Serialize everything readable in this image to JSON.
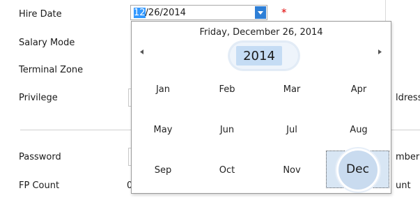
{
  "form": {
    "labels": {
      "hire_date": "Hire Date",
      "salary_mode": "Salary Mode",
      "terminal_zone": "Terminal Zone",
      "privilege": "Privilege",
      "password": "Password",
      "fp_count": "FP Count"
    },
    "hire_date_value_selected": "12",
    "hire_date_value_rest": "/26/2014",
    "fp_count_partial": "0",
    "required_marker": "*",
    "right_clipped": {
      "address": "ldress",
      "number": "mber",
      "count": "unt"
    }
  },
  "calendar": {
    "current_date_text": "Friday, December 26, 2014",
    "year": "2014",
    "prev_icon": "triangle-left",
    "next_icon": "triangle-right",
    "months": [
      "Jan",
      "Feb",
      "Mar",
      "Apr",
      "May",
      "Jun",
      "Jul",
      "Aug",
      "Sep",
      "Oct",
      "Nov",
      "Dec"
    ],
    "selected_month": "Dec"
  },
  "colors": {
    "accent": "#2e7fd6",
    "selection": "#3399ff",
    "required": "#e00000",
    "year_highlight": "#c5dcf4"
  }
}
